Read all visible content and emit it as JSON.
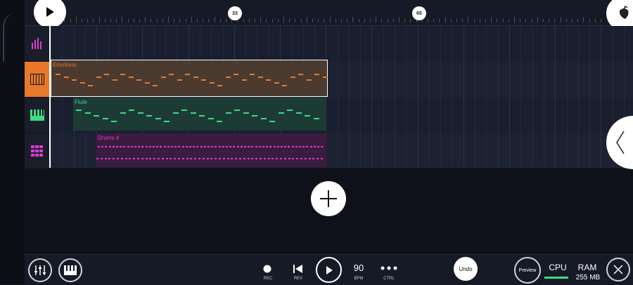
{
  "timeline": {
    "markers": [
      "33",
      "65"
    ]
  },
  "tracks": [
    {
      "name": "Emotions",
      "color": "#e8782c",
      "icon": "piano-icon"
    },
    {
      "name": "Flute",
      "color": "#3ddc84",
      "icon": "piano-icon"
    },
    {
      "name": "Drums 4",
      "color": "#e03ad1",
      "icon": "drum-pads-icon"
    }
  ],
  "toolbar": {
    "rec_label": "REC",
    "rev_label": "REV",
    "bpm_value": "90",
    "bpm_label": "BPM",
    "ctrl_label": "CTRL",
    "undo_label": "Undo",
    "preview_label": "Preview",
    "cpu_label": "CPU",
    "ram_label": "RAM",
    "ram_value": "255 MB"
  },
  "colors": {
    "accent": "#e8782c",
    "cpu_meter": "#3ddc84"
  }
}
